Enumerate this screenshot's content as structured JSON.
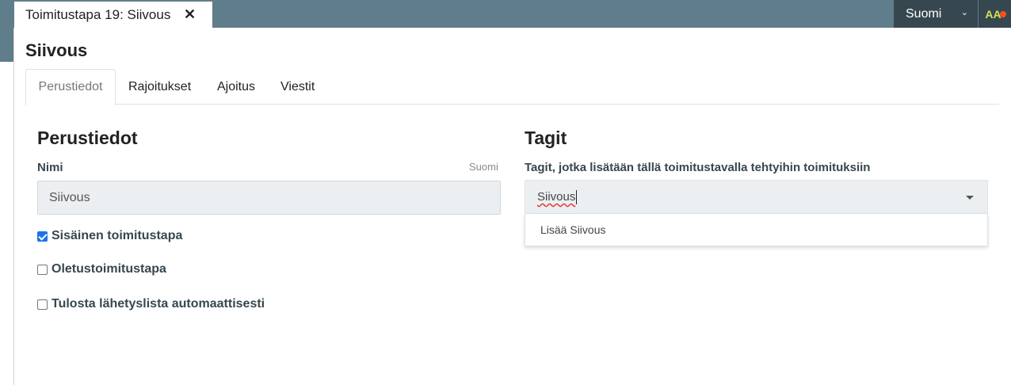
{
  "window_tab": {
    "title": "Toimitustapa 19: Siivous",
    "close_glyph": "✕"
  },
  "language_selector": {
    "value": "Suomi",
    "chevron": "⌄"
  },
  "user_avatar": {
    "initials": "AA"
  },
  "page": {
    "title": "Siivous"
  },
  "tabs": [
    {
      "label": "Perustiedot",
      "active": true
    },
    {
      "label": "Rajoitukset",
      "active": false
    },
    {
      "label": "Ajoitus",
      "active": false
    },
    {
      "label": "Viestit",
      "active": false
    }
  ],
  "basic_info": {
    "heading": "Perustiedot",
    "name_label": "Nimi",
    "name_language": "Suomi",
    "name_value": "Siivous",
    "checkboxes": [
      {
        "label": "Sisäinen toimitustapa",
        "checked": true
      },
      {
        "label": "Oletustoimitustapa",
        "checked": false
      },
      {
        "label": "Tulosta lähetyslista automaattisesti",
        "checked": false
      }
    ]
  },
  "tags": {
    "heading": "Tagit",
    "description": "Tagit, jotka lisätään tällä toimitustavalla tehtyihin toimituksiin",
    "input_value": "Siivous",
    "dropdown_option": "Lisää Siivous"
  },
  "colors": {
    "topbar": "#607d8b",
    "dark_bar": "#37474f",
    "avatar_text": "#d4e157",
    "notification_dot": "#f4511e",
    "checkbox_checked": "#1a73e8"
  }
}
